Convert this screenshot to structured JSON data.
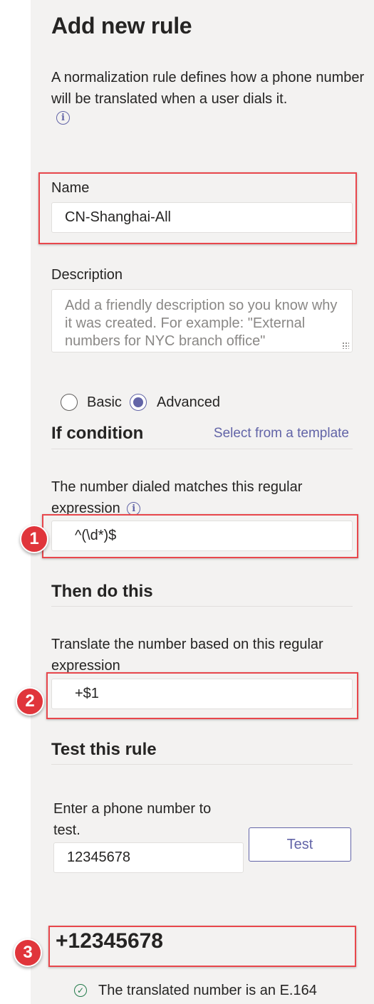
{
  "page": {
    "title": "Add new rule",
    "intro": "A normalization rule defines how a phone number will be translated when a user dials it."
  },
  "name_field": {
    "label": "Name",
    "value": "CN-Shanghai-All"
  },
  "description_field": {
    "label": "Description",
    "placeholder": "Add a friendly description so you know why it was created. For example: \"External numbers for NYC branch office\""
  },
  "mode": {
    "options": [
      "Basic",
      "Advanced"
    ],
    "selected": "Advanced"
  },
  "condition": {
    "title": "If condition",
    "template_link": "Select from a template",
    "label": "The number dialed matches this regular expression",
    "value": "^(\\d*)$"
  },
  "action": {
    "title": "Then do this",
    "label": "Translate the number based on this regular expression",
    "value": "+$1"
  },
  "test": {
    "title": "Test this rule",
    "label": "Enter a phone number to test.",
    "input_value": "12345678",
    "button_label": "Test",
    "result": "+12345678",
    "status": "The translated number is an E.164"
  },
  "callouts": [
    "1",
    "2",
    "3"
  ],
  "icons": {
    "info": "info-icon",
    "check": "check-circle-icon"
  },
  "colors": {
    "accent": "#6264a7",
    "highlight": "#e8474c",
    "success": "#237b4b"
  }
}
